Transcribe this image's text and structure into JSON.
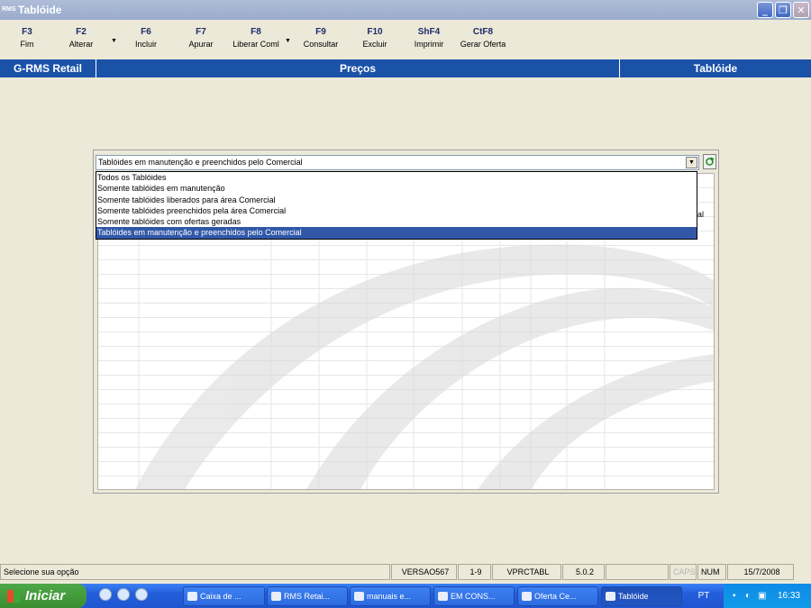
{
  "window": {
    "app_icon": "RMS",
    "title": "Tablóide"
  },
  "toolbar": {
    "buttons": [
      {
        "key": "F3",
        "label": "Fim"
      },
      {
        "key": "F2",
        "label": "Alterar"
      },
      {
        "key": "F6",
        "label": "Incluir"
      },
      {
        "key": "F7",
        "label": "Apurar"
      },
      {
        "key": "F8",
        "label": "Liberar Coml"
      },
      {
        "key": "F9",
        "label": "Consultar"
      },
      {
        "key": "F10",
        "label": "Excluir"
      },
      {
        "key": "ShF4",
        "label": "Imprimir"
      },
      {
        "key": "CtF8",
        "label": "Gerar Oferta"
      }
    ]
  },
  "header": {
    "left": "G-RMS Retail",
    "center": "Preços",
    "right": "Tablóide"
  },
  "filter": {
    "selected": "Tablóides em manutenção e preenchidos pelo Comercial",
    "options": [
      "Todos os Tablóides",
      "Somente tablóides em manutenção",
      "Somente tablóides liberados para área Comercial",
      "Somente tablóides preenchidos pela área Comercial",
      "Somente tablóides com ofertas geradas",
      "Tablóides em manutenção e preenchidos pelo Comercial"
    ],
    "partial_text": "ial"
  },
  "status": {
    "message": "Selecione sua opção",
    "version": "VERSAO567",
    "range": "1-9",
    "program": "VPRCTABL",
    "build": "5.0.2",
    "caps": "CAPS",
    "num": "NUM",
    "date": "15/7/2008"
  },
  "taskbar": {
    "start_label": "Iniciar",
    "tasks": [
      "Caixa de ...",
      "RMS Retai...",
      "manuais e...",
      "EM CONS...",
      "Oferta Ce...",
      "Tablóide"
    ],
    "lang": "PT",
    "clock": "16:33"
  }
}
